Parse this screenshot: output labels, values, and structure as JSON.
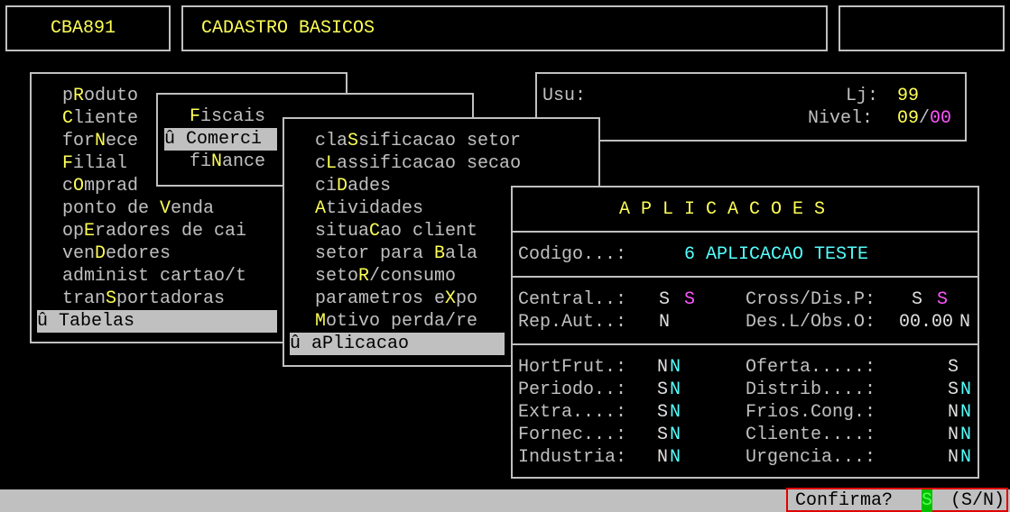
{
  "header": {
    "program_code": "CBA891",
    "screen_title": "CADASTRO BASICOS",
    "right_box": ""
  },
  "main_menu": {
    "items": [
      {
        "text": "pRoduto",
        "hot": "R"
      },
      {
        "text": "Cliente",
        "hot": "C"
      },
      {
        "text": "forNece",
        "hot": "N"
      },
      {
        "text": "Filial",
        "hot": "F"
      },
      {
        "text": "cOmprad",
        "hot": "O"
      },
      {
        "text": "ponto de Venda",
        "hot": "V"
      },
      {
        "text": "opEradores de cai",
        "hot": "E"
      },
      {
        "text": "venDedores",
        "hot": "D"
      },
      {
        "text": "administ cartao/t",
        "hot": ""
      },
      {
        "text": "tranSportadoras",
        "hot": "S"
      }
    ],
    "selected_marker": "û",
    "selected_label": "Tabelas"
  },
  "submenu": {
    "items": [
      {
        "text": "Fiscais",
        "hot": "F"
      },
      {
        "text": "Comerci",
        "hot": ""
      },
      {
        "text": "fiNance",
        "hot": "N"
      }
    ],
    "selected_marker": "û",
    "selected_label": "Comerci"
  },
  "tables_menu": {
    "items": [
      {
        "text": "claSsificacao setor",
        "hot": "S"
      },
      {
        "text": "cLassificacao secao",
        "hot": "L"
      },
      {
        "text": "ciDades",
        "hot": "D"
      },
      {
        "text": "Atividades",
        "hot": "A"
      },
      {
        "text": "situaCao client",
        "hot": "C"
      },
      {
        "text": "setor para Bala",
        "hot": "B"
      },
      {
        "text": "setoR/consumo",
        "hot": "R"
      },
      {
        "text": "parametros eXpo",
        "hot": "X"
      },
      {
        "text": "Motivo perda/re",
        "hot": "M"
      }
    ],
    "selected_marker": "û",
    "selected_label": "aPlicacao"
  },
  "user_panel": {
    "usu_label": "Usu:",
    "lj_label": "Lj:",
    "lj_value": "99",
    "nivel_label": "Nivel:",
    "nivel_value_a": "09",
    "nivel_sep": "/",
    "nivel_value_b": "00"
  },
  "aplicacoes": {
    "title": "A P L I C A C O E S",
    "codigo_label": "Codigo...:",
    "codigo_value": "6 APLICACAO TESTE",
    "central_label": "Central..:",
    "central_v1": "S",
    "central_v2": "S",
    "cross_label": "Cross/Dis.P:",
    "cross_v1": "S",
    "cross_v2": "S",
    "repaut_label": "Rep.Aut..:",
    "repaut_v": "N",
    "desl_label": "Des.L/Obs.O:",
    "desl_v1": "00.00",
    "desl_v2": "N",
    "fields": [
      {
        "label": "HortFrut.:",
        "v1": "N",
        "v2": "N"
      },
      {
        "label": "Periodo..:",
        "v1": "S",
        "v2": "N"
      },
      {
        "label": "Extra....:",
        "v1": "S",
        "v2": "N"
      },
      {
        "label": "Fornec...:",
        "v1": "S",
        "v2": "N"
      },
      {
        "label": "Industria:",
        "v1": "N",
        "v2": "N"
      }
    ],
    "fields_right": [
      {
        "label": "Oferta.....:",
        "v1": "S",
        "v2": ""
      },
      {
        "label": "Distrib....:",
        "v1": "S",
        "v2": "N"
      },
      {
        "label": "Frios.Cong.:",
        "v1": "N",
        "v2": "N"
      },
      {
        "label": "Cliente....:",
        "v1": "N",
        "v2": "N"
      },
      {
        "label": "Urgencia...:",
        "v1": "N",
        "v2": "N"
      }
    ]
  },
  "status": {
    "prompt": "Confirma?",
    "answer": "S",
    "options": "(S/N)"
  },
  "colors": {
    "hotkey": "#ffff55",
    "value": "#55ffff",
    "magenta": "#ff55ff",
    "answer_bg": "#00c000",
    "confirm_border": "#e00000"
  }
}
